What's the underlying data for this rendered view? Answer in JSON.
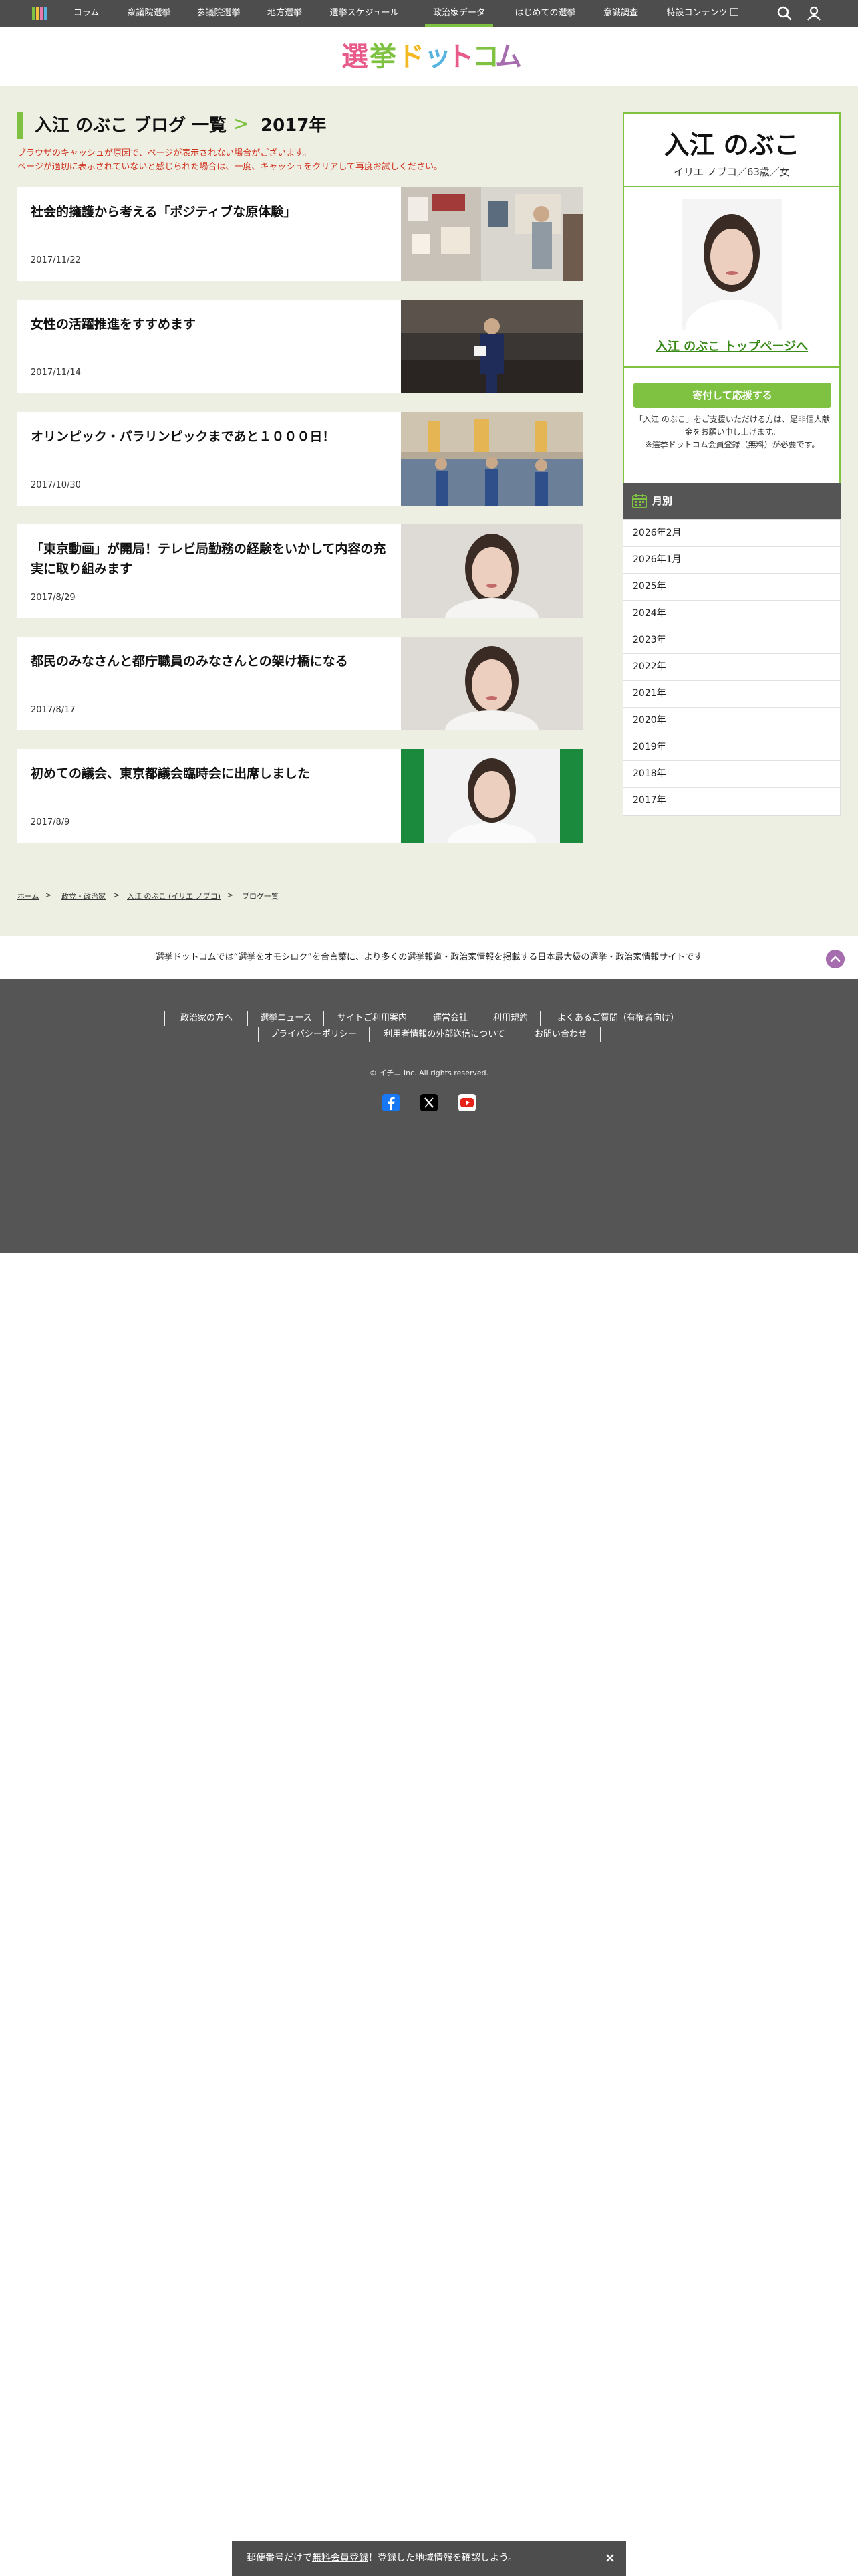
{
  "nav": {
    "items": [
      "コラム",
      "衆議院選挙",
      "参議院選挙",
      "地方選挙",
      "選挙スケジュール",
      "政治家データ",
      "はじめての選挙",
      "意識調査",
      "特設コンテンツ"
    ],
    "active_item": "政治家データ",
    "icons": [
      "search-icon",
      "user-icon",
      "external-link-icon"
    ]
  },
  "header": {
    "logo_text": "選挙ドットコム"
  },
  "page": {
    "title": "入江 のぶこ ブログ 一覧",
    "separator": ">",
    "year": "2017年",
    "notice_lines": [
      "ブラウザのキャッシュが原因で、ページが表示されない場合がございます。",
      "ページが適切に表示されていないと感じられた場合は、一度、キャッシュをクリアして再度お試しください。"
    ]
  },
  "posts": [
    {
      "title": "社会的擁護から考える「ポジティブな原体験」",
      "date": "2017/11/22"
    },
    {
      "title": "女性の活躍推進をすすめます",
      "date": "2017/11/14"
    },
    {
      "title": "オリンピック・パラリンピックまであと１０００日！",
      "date": "2017/10/30"
    },
    {
      "title": "「東京動画」が開局！テレビ局勤務の経験をいかして内容の充実に取り組みます",
      "date": "2017/8/29"
    },
    {
      "title": "都民のみなさんと都庁職員のみなさんとの架け橋になる",
      "date": "2017/8/17"
    },
    {
      "title": "初めての議会、東京都議会臨時会に出席しました",
      "date": "2017/8/9"
    }
  ],
  "sidebar": {
    "name": "入江 のぶこ",
    "kana_age_gender": "イリエ ノブコ／63歳／女",
    "top_link": "入江 のぶこ トップページへ",
    "donate_button": "寄付して応援する",
    "donate_lines": [
      "「入江 のぶこ」をご支援いただける方は、是非個人献",
      "金をお願い申し上げます。",
      "※選挙ドットコム会員登録（無料）が必要です。"
    ],
    "month_heading": "月別",
    "months": [
      "2026年2月",
      "2026年1月",
      "2025年",
      "2024年",
      "2023年",
      "2022年",
      "2021年",
      "2020年",
      "2019年",
      "2018年",
      "2017年"
    ]
  },
  "breadcrumb": {
    "items": [
      "ホーム",
      "政党・政治家",
      "入江 のぶこ (イリエ ノブコ)",
      "ブログ一覧"
    ],
    "separator": ">"
  },
  "tagline": "選挙ドットコムでは“選挙をオモシロク”を合言葉に、より多くの選挙報道・政治家情報を掲載する日本最大級の選挙・政治家情報サイトです",
  "footer": {
    "links_row1": [
      "政治家の方へ",
      "選挙ニュース",
      "サイトご利用案内",
      "運営会社",
      "利用規約",
      "よくあるご質問（有権者向け）"
    ],
    "links_row2": [
      "プライバシーポリシー",
      "利用者情報の外部送信について",
      "お問い合わせ"
    ],
    "copyright": "© イチニ Inc. All rights reserved.",
    "social": [
      "facebook-icon",
      "x-icon",
      "youtube-icon"
    ]
  },
  "bottom_notice": {
    "prefix": "郵便番号だけで",
    "link": "無料会員登録",
    "suffix": "！登録した地域情報を確認しよう。"
  },
  "colors": {
    "accent": "#7fc241",
    "nav_bg": "#4d4d4d",
    "main_bg": "#eeefe3",
    "notice": "#d0321e",
    "footer_bg": "#555555",
    "totop": "#a56cae"
  }
}
